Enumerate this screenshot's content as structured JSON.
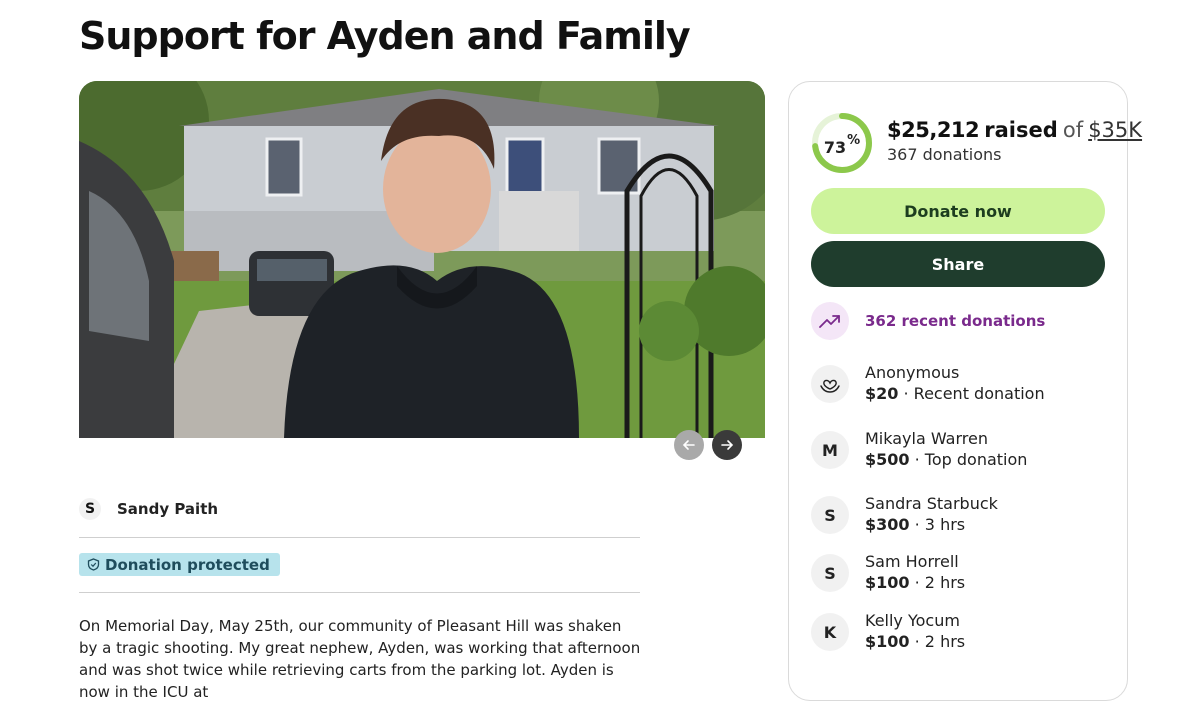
{
  "page": {
    "title": "Support for Ayden and Family"
  },
  "organizer": {
    "avatar_letter": "S",
    "name": "Sandy Paith"
  },
  "badge": {
    "label": "Donation protected"
  },
  "story": {
    "text": "On Memorial Day, May 25th, our community of Pleasant Hill was shaken by a tragic shooting. My great nephew, Ayden, was working that afternoon and was shot twice while retrieving carts from the parking lot. Ayden is now in the ICU at"
  },
  "carousel": {
    "prev_icon": "arrow-left-icon",
    "next_icon": "arrow-right-icon"
  },
  "progress": {
    "percent_value": 73,
    "percent_number": "73",
    "percent_symbol": "%",
    "ring_color": "#8cc84b",
    "track_color": "#e6f3d8"
  },
  "fundraiser": {
    "raised_amount": "$25,212",
    "raised_word": "raised",
    "of_word": "of",
    "goal": "$35K",
    "donations_count": "367 donations"
  },
  "buttons": {
    "donate": "Donate now",
    "share": "Share"
  },
  "recent": {
    "icon": "trending-up-icon",
    "label": "362 recent donations"
  },
  "donors": [
    {
      "avatar": "hand-heart-icon",
      "name": "Anonymous",
      "amount": "$20",
      "note": "Recent donation"
    },
    {
      "avatar": "M",
      "name": "Mikayla Warren",
      "amount": "$500",
      "note": "Top donation"
    },
    {
      "avatar": "S",
      "name": "Sandra Starbuck",
      "amount": "$300",
      "note": "3 hrs"
    },
    {
      "avatar": "S",
      "name": "Sam Horrell",
      "amount": "$100",
      "note": "2 hrs"
    },
    {
      "avatar": "K",
      "name": "Kelly Yocum",
      "amount": "$100",
      "note": "2 hrs"
    }
  ],
  "colors": {
    "accent_green": "#cdf39b",
    "dark_green": "#1f3d2d",
    "recent_purple": "#7a2a8c",
    "badge_blue": "#b7e3ec"
  }
}
